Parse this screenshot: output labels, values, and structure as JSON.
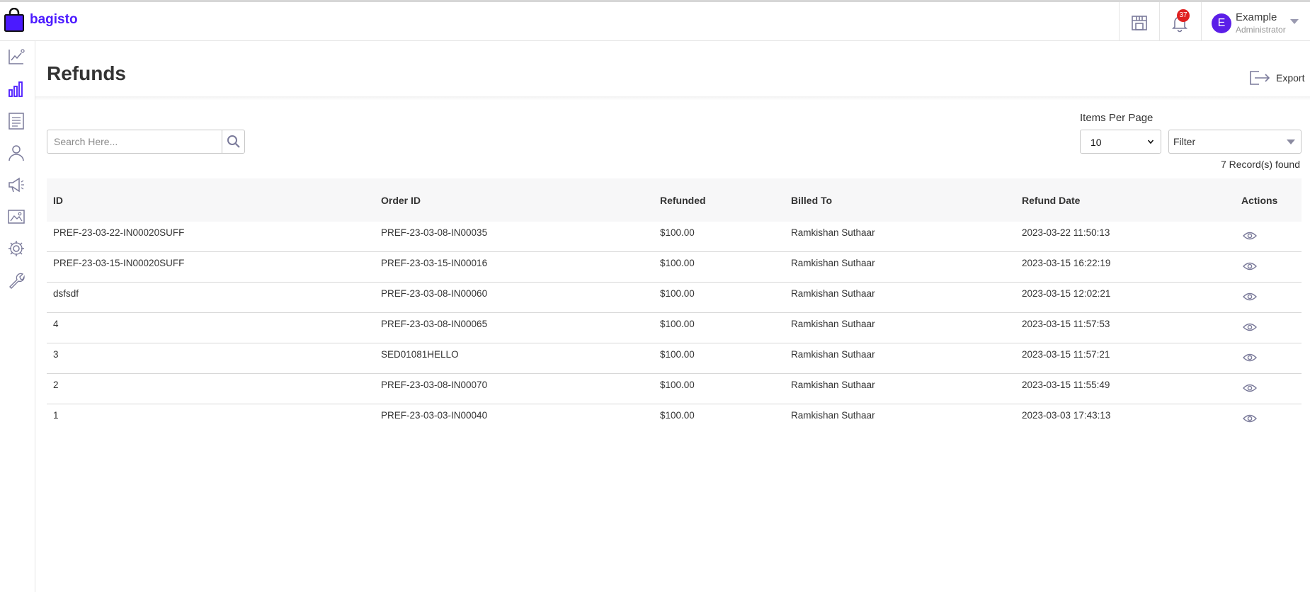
{
  "app": {
    "logo_text": "bagisto"
  },
  "header": {
    "notification_count": "37",
    "user": {
      "initial": "E",
      "name": "Example",
      "role": "Administrator"
    }
  },
  "sidebar": {
    "items": [
      {
        "name": "dashboard",
        "icon": "line-chart-icon"
      },
      {
        "name": "reports",
        "icon": "bar-chart-icon",
        "active": true
      },
      {
        "name": "catalog",
        "icon": "document-icon"
      },
      {
        "name": "customers",
        "icon": "user-icon"
      },
      {
        "name": "marketing",
        "icon": "megaphone-icon"
      },
      {
        "name": "cms",
        "icon": "image-icon"
      },
      {
        "name": "settings",
        "icon": "gear-icon"
      },
      {
        "name": "configure",
        "icon": "wrench-icon"
      }
    ]
  },
  "page": {
    "title": "Refunds",
    "export_label": "Export"
  },
  "toolbar": {
    "search_placeholder": "Search Here...",
    "items_per_page_label": "Items Per Page",
    "items_per_page_value": "10",
    "filter_label": "Filter",
    "records_found": "7 Record(s) found"
  },
  "table": {
    "columns": [
      "ID",
      "Order ID",
      "Refunded",
      "Billed To",
      "Refund Date",
      "Actions"
    ],
    "rows": [
      {
        "id": "PREF-23-03-22-IN00020SUFF",
        "order_id": "PREF-23-03-08-IN00035",
        "refunded": "$100.00",
        "billed_to": "Ramkishan Suthaar",
        "refund_date": "2023-03-22 11:50:13"
      },
      {
        "id": "PREF-23-03-15-IN00020SUFF",
        "order_id": "PREF-23-03-15-IN00016",
        "refunded": "$100.00",
        "billed_to": "Ramkishan Suthaar",
        "refund_date": "2023-03-15 16:22:19"
      },
      {
        "id": "dsfsdf",
        "order_id": "PREF-23-03-08-IN00060",
        "refunded": "$100.00",
        "billed_to": "Ramkishan Suthaar",
        "refund_date": "2023-03-15 12:02:21"
      },
      {
        "id": "4",
        "order_id": "PREF-23-03-08-IN00065",
        "refunded": "$100.00",
        "billed_to": "Ramkishan Suthaar",
        "refund_date": "2023-03-15 11:57:53"
      },
      {
        "id": "3",
        "order_id": "SED01081HELLO",
        "refunded": "$100.00",
        "billed_to": "Ramkishan Suthaar",
        "refund_date": "2023-03-15 11:57:21"
      },
      {
        "id": "2",
        "order_id": "PREF-23-03-08-IN00070",
        "refunded": "$100.00",
        "billed_to": "Ramkishan Suthaar",
        "refund_date": "2023-03-15 11:55:49"
      },
      {
        "id": "1",
        "order_id": "PREF-23-03-03-IN00040",
        "refunded": "$100.00",
        "billed_to": "Ramkishan Suthaar",
        "refund_date": "2023-03-03 17:43:13"
      }
    ]
  },
  "colors": {
    "brand": "#4b1aff",
    "avatar": "#5b1ee8",
    "badge": "#e02020",
    "icon": "#7a7a9a"
  }
}
